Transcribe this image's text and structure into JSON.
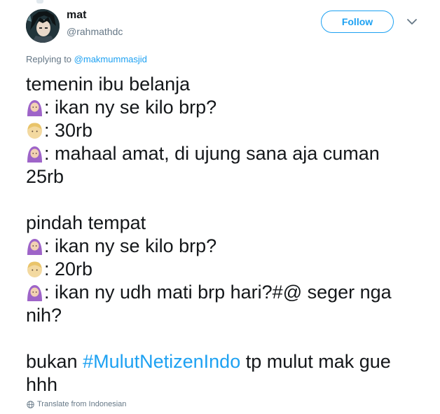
{
  "tweet_header": {
    "display_name": "mat",
    "screen_name": "@rahmathdc",
    "follow_label": "Follow",
    "avatar_icon": "avatar-anime-portrait-icon",
    "menu_icon": "chevron-down-icon"
  },
  "reply_context": {
    "prefix": "Replying to",
    "mention": "@makmummasjid"
  },
  "tweet_text": {
    "l1": "temenin ibu belanja",
    "l2": ": ikan ny se kilo brp?",
    "l3": ": 30rb",
    "l4": ": mahaal amat, di ujung sana aja cuman",
    "l5": "25rb",
    "l7": "pindah tempat",
    "l8": ": ikan ny se kilo brp?",
    "l9": ": 20rb",
    "l10": ": ikan ny udh mati brp hari?#@ seger nga",
    "l11": "nih?",
    "l13_before": "bukan ",
    "l13_hashtag": "#MulutNetizenIndo",
    "l13_after": " tp mulut mak gue",
    "l14": "hhh",
    "emojis": {
      "buyer": "woman-with-headscarf-emoji",
      "seller": "blond-person-emoji"
    }
  },
  "footer": {
    "translate_label": "Translate from Indonesian",
    "translate_icon": "globe-icon"
  },
  "colors": {
    "accent": "#1da1f2",
    "text": "#14171a",
    "muted": "#657786"
  }
}
